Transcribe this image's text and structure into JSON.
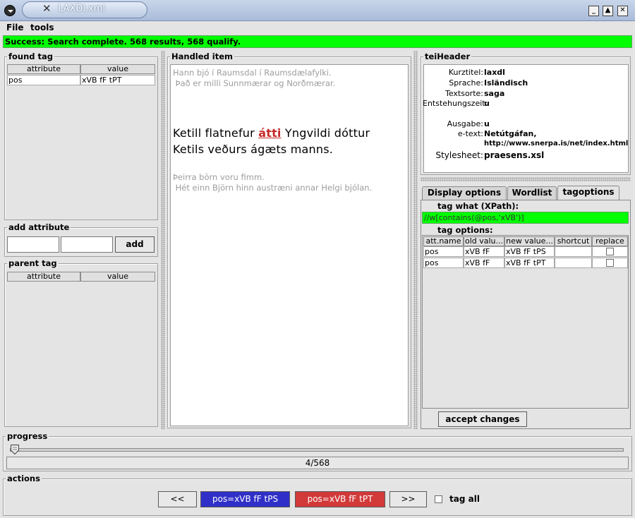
{
  "window": {
    "title": "LAXDl.xml",
    "minimize": "_",
    "maximize": "▲",
    "close": "✕"
  },
  "menu": {
    "file": "File",
    "tools": "tools"
  },
  "status_text": "Success:  Search complete. 568 results, 568 qualify.",
  "found_tag": {
    "title": "found tag",
    "headers": [
      "attribute",
      "value"
    ],
    "rows": [
      [
        "pos",
        "xVB fF tPT"
      ]
    ]
  },
  "add_attribute": {
    "title": "add attribute",
    "button": "add"
  },
  "parent_tag": {
    "title": "parent tag",
    "headers": [
      "attribute",
      "value"
    ]
  },
  "handled_item": {
    "title": "Handled item",
    "context_before": [
      "Hann bjó í Raumsdal í Raumsdælafylki.",
      " Það er milli Sunnmærar og Norðmærar."
    ],
    "sentence_pre": "Ketill flatnefur ",
    "focus_word": "átti",
    "sentence_post": " Yngvildi dóttur",
    "sentence_line2": "Ketils veðurs ágæts manns.",
    "context_after": [
      "Þeirra börn voru fimm.",
      " Hét einn Björn hinn austræni annar Helgi bjólan."
    ]
  },
  "tei_header": {
    "title": "teiHeader",
    "fields": [
      {
        "label": "Kurztitel:",
        "value": "laxdl"
      },
      {
        "label": "Sprache:",
        "value": "Isländisch"
      },
      {
        "label": "Textsorte:",
        "value": "saga"
      },
      {
        "label": "Entstehungszeit:",
        "value": "u"
      },
      {
        "label": "Ausgabe:",
        "value": "u"
      },
      {
        "label": "e-text:",
        "value": "Netútgáfan,"
      },
      {
        "label": "",
        "value": "http://www.snerpa.is/net/index.html"
      },
      {
        "label": "Stylesheet:",
        "value": "praesens.xsl"
      }
    ]
  },
  "tabs": [
    "Display options",
    "Wordlist",
    "tagoptions"
  ],
  "active_tab": "tagoptions",
  "tag_what": {
    "label": "tag what (XPath):",
    "value": "//w[contains(@pos,'xVB')]"
  },
  "tag_options": {
    "label": "tag options:",
    "headers": [
      "att.name",
      "old valu...",
      "new value...",
      "shortcut",
      "replace"
    ],
    "rows": [
      {
        "name": "pos",
        "old": "xVB fF",
        "new": "xVB fF tPS",
        "shortcut": "",
        "replace": false
      },
      {
        "name": "pos",
        "old": "xVB fF",
        "new": "xVB fF tPT",
        "shortcut": "",
        "replace": false
      }
    ]
  },
  "accept_button": "accept changes",
  "progress": {
    "title": "progress",
    "current": 4,
    "total": 568,
    "text": "4/568"
  },
  "actions": {
    "title": "actions",
    "prev": "<<",
    "opt1": "pos=xVB fF tPS",
    "opt2": "pos=xVB fF tPT",
    "next": ">>",
    "tag_all": "tag all",
    "opt1_color": "#3030c8",
    "opt2_color": "#d23a3a"
  },
  "colors": {
    "status_ok": "#00ff00"
  }
}
